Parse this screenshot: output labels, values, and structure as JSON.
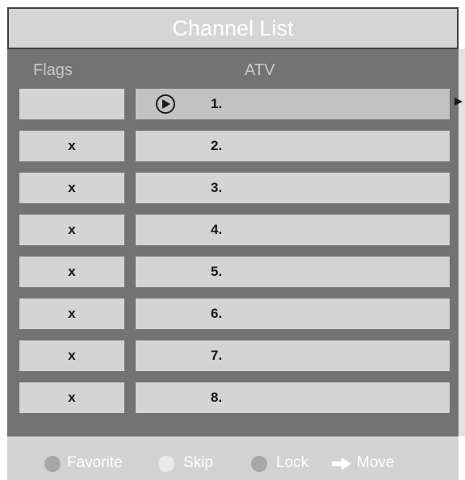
{
  "title": "Channel List",
  "columns": {
    "flags": "Flags",
    "atv": "ATV"
  },
  "rows": [
    {
      "flag": "",
      "number": "1."
    },
    {
      "flag": "x",
      "number": "2."
    },
    {
      "flag": "x",
      "number": "3."
    },
    {
      "flag": "x",
      "number": "4."
    },
    {
      "flag": "x",
      "number": "5."
    },
    {
      "flag": "x",
      "number": "6."
    },
    {
      "flag": "x",
      "number": "7."
    },
    {
      "flag": "x",
      "number": "8."
    }
  ],
  "selected_row": 0,
  "selected_icon": "play-icon",
  "legend": [
    {
      "label": "Favorite",
      "icon": "favorite-dot",
      "color": "#a7a7a7"
    },
    {
      "label": "Skip",
      "icon": "skip-dot",
      "color": "#e9e9e9"
    },
    {
      "label": "Lock",
      "icon": "lock-dot",
      "color": "#a7a7a7"
    },
    {
      "label": "Move",
      "icon": "arrow-right-icon",
      "color": "#ffffff"
    }
  ]
}
